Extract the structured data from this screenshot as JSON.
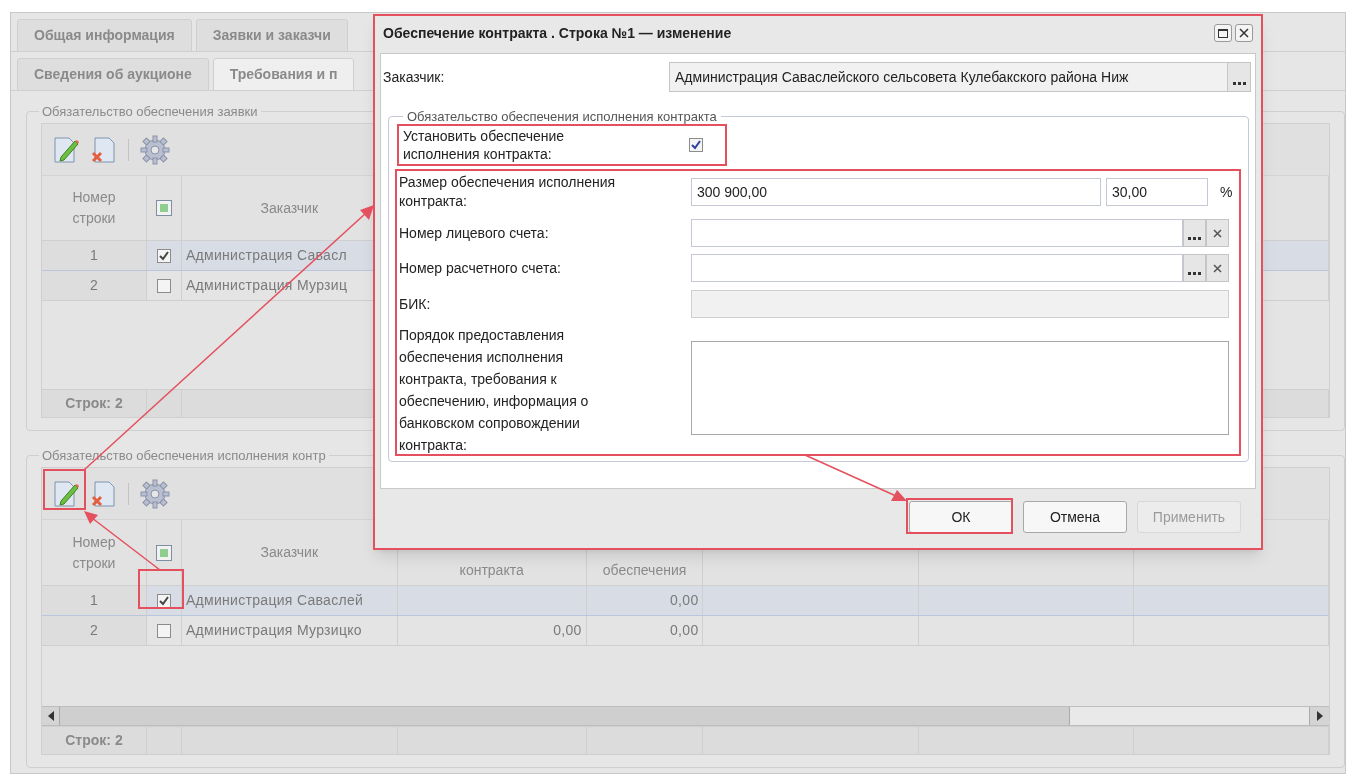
{
  "tabs_row_1": [
    {
      "label": "Общая информация",
      "selected": false
    },
    {
      "label": "Заявки и заказчи",
      "selected": false
    }
  ],
  "tabs_row_2": [
    {
      "label": "Сведения об аукционе",
      "selected": false
    },
    {
      "label": "Требования и п",
      "selected": true
    }
  ],
  "application_security": {
    "legend": "Обязательство обеспечения заявки",
    "columns": [
      "Номер строки",
      "Заказчик"
    ],
    "rows": [
      {
        "number": "1",
        "checked": true,
        "selected": true,
        "customer": "Администрация Савасл"
      },
      {
        "number": "2",
        "checked": false,
        "selected": false,
        "customer": "Администрация Мурзиц"
      }
    ],
    "footer": "Строк: 2"
  },
  "contract_security": {
    "legend": "Обязательство обеспечения исполнения контр",
    "columns": [
      "Номер строки",
      "Заказчик",
      "контракта",
      "обеспечения"
    ],
    "rows": [
      {
        "number": "1",
        "checked": true,
        "selected": true,
        "customer": "Администрация Саваслей",
        "security": "0,00"
      },
      {
        "number": "2",
        "checked": false,
        "selected": false,
        "customer": "Администрация Мурзицко",
        "contract": "0,00",
        "security": "0,00"
      }
    ],
    "footer": "Строк: 2"
  },
  "dialog": {
    "title": "Обеспечение контракта . Строка №1 — изменение",
    "customer": {
      "label": "Заказчик:",
      "value": "Администрация Саваслейского сельсовета Кулебакского района Ниж"
    },
    "legend": "Обязательство обеспечения исполнения контракта",
    "set_security": {
      "label": "Установить обеспечение исполнения контракта:",
      "checked": true
    },
    "fields": [
      {
        "kind": "amount",
        "label": "Размер обеспечения исполнения контракта:",
        "value": "300 900,00",
        "percent": "30,00",
        "unit": "%"
      },
      {
        "kind": "lookup",
        "label": "Номер лицевого счета:"
      },
      {
        "kind": "lookup",
        "label": "Номер расчетного счета:"
      },
      {
        "kind": "readonly",
        "label": "БИК:"
      },
      {
        "kind": "textarea",
        "label": "Порядок предоставления обеспечения исполнения контракта, требования к обеспечению, информация о банковском сопровождении контракта:"
      }
    ],
    "buttons": [
      {
        "label": "ОК",
        "disabled": false
      },
      {
        "label": "Отмена",
        "disabled": false
      },
      {
        "label": "Применить",
        "disabled": true
      }
    ]
  }
}
